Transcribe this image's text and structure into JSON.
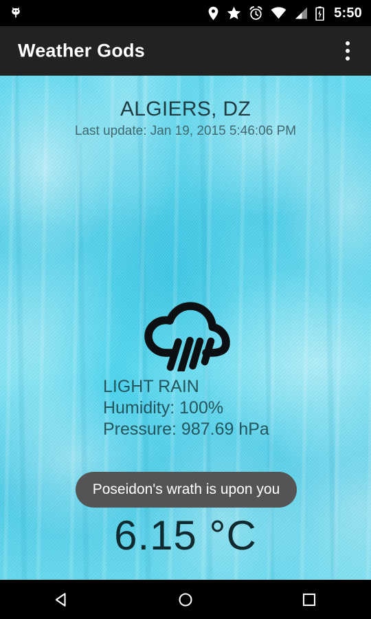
{
  "status_bar": {
    "clock": "5:50",
    "icons": [
      "android-head-icon",
      "location-pin-icon",
      "star-icon",
      "alarm-clock-icon",
      "wifi-icon",
      "cell-signal-icon",
      "battery-charging-icon"
    ]
  },
  "app_bar": {
    "title": "Weather Gods",
    "overflow_label": "overflow-menu",
    "background_color": "#222222"
  },
  "weather": {
    "location": "ALGIERS, DZ",
    "last_update": "Last update: Jan 19, 2015 5:46:06 PM",
    "icon": "rain-cloud-icon",
    "condition": "LIGHT RAIN",
    "humidity": "Humidity: 100%",
    "pressure": "Pressure: 987.69 hPa",
    "wrath_message": "Poseidon's wrath is upon you",
    "temperature": "6.15 °C",
    "background_color": "#5fd4ea",
    "text_color": "#23555e",
    "pill_color": "#545454"
  },
  "nav_bar": {
    "back_label": "back-button",
    "home_label": "home-button",
    "recents_label": "recents-button"
  }
}
